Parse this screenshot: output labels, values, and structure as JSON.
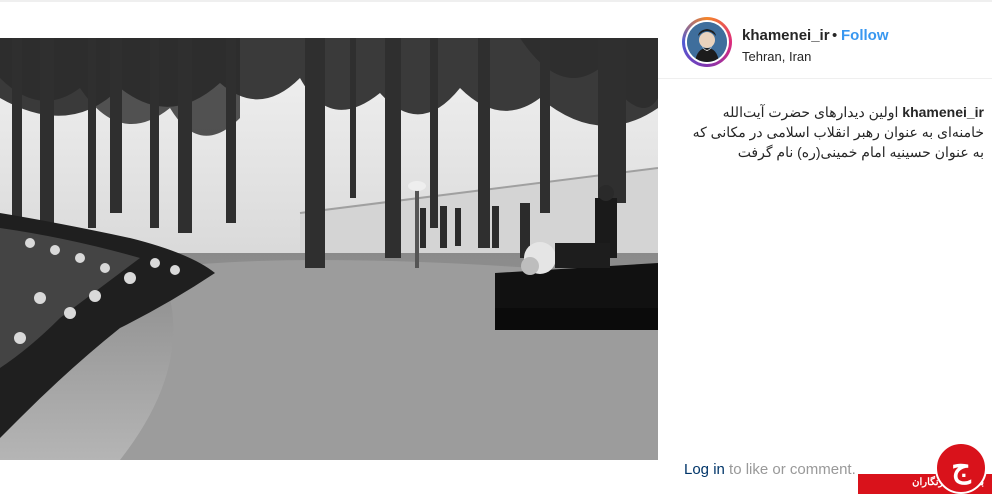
{
  "post": {
    "username": "khamenei_ir",
    "separator": "•",
    "follow_label": "Follow",
    "location": "Tehran, Iran",
    "caption": {
      "username": "khamenei_ir",
      "text": "اولین دیدارهای حضرت آیت‌الله خامنه‌ای به عنوان رهبر انقلاب اسلامی در مکانی که به عنوان حسینیه امام خمینی(ره) نام گرفت"
    },
    "footer": {
      "login_label": "Log in",
      "rest_label": " to like or comment."
    }
  },
  "watermark": {
    "text": "باشگاه خبرنگاران",
    "logo_glyph": "ج"
  },
  "colors": {
    "link_blue": "#3897f0",
    "text": "#262626",
    "muted": "#999999",
    "watermark_red": "#d9121b"
  },
  "icons": {
    "avatar": "profile-photo",
    "watermark": "yjc-logo"
  }
}
